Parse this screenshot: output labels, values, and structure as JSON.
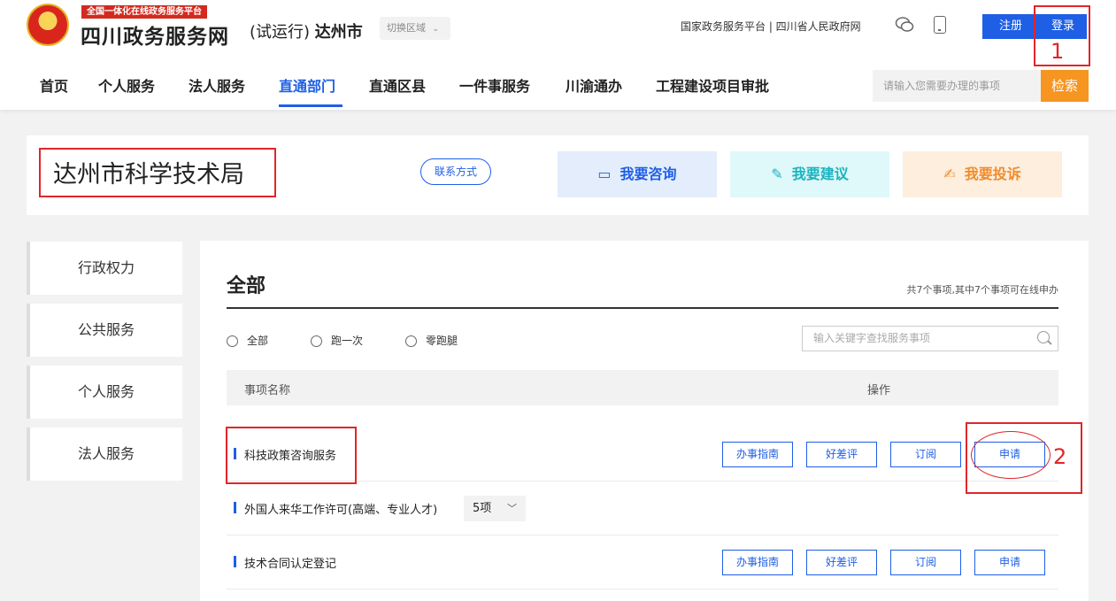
{
  "header": {
    "slogan": "全国一体化在线政务服务平台",
    "site_name": "四川政务服务网",
    "trial": "(试运行)",
    "city": "达州市",
    "switch_region": "切换区域",
    "top_links": "国家政务服务平台 | 四川省人民政府网",
    "register": "注册",
    "login": "登录"
  },
  "nav": {
    "items": [
      "首页",
      "个人服务",
      "法人服务",
      "直通部门",
      "直通区县",
      "一件事服务",
      "川渝通办",
      "工程建设项目审批"
    ],
    "active": "直通部门",
    "search_placeholder": "请输入您需要办理的事项",
    "search_button": "检索"
  },
  "department": {
    "title": "达州市科学技术局",
    "contact": "联系方式",
    "actions": {
      "consult": "我要咨询",
      "suggest": "我要建议",
      "complain": "我要投诉"
    }
  },
  "sidebar": {
    "items": [
      "行政权力",
      "公共服务",
      "个人服务",
      "法人服务"
    ]
  },
  "panel": {
    "title": "全部",
    "count_text": "共7个事项,其中7个事项可在线申办",
    "filters": [
      "全部",
      "跑一次",
      "零跑腿"
    ],
    "filter_placeholder": "输入关键字查找服务事项",
    "col_name": "事项名称",
    "col_op": "操作",
    "rows": [
      {
        "name": "科技政策咨询服务",
        "ops": [
          "办事指南",
          "好差评",
          "订阅",
          "申请"
        ]
      },
      {
        "name": "外国人来华工作许可(高端、专业人才)",
        "count": "5项"
      },
      {
        "name": "技术合同认定登记",
        "ops": [
          "办事指南",
          "好差评",
          "订阅",
          "申请"
        ]
      }
    ]
  },
  "annotations": {
    "num1": "1",
    "num2": "2",
    "color": "#e0262a"
  },
  "colors": {
    "primary": "#1e5fe6",
    "orange": "#f79521",
    "red": "#d32a1f"
  }
}
